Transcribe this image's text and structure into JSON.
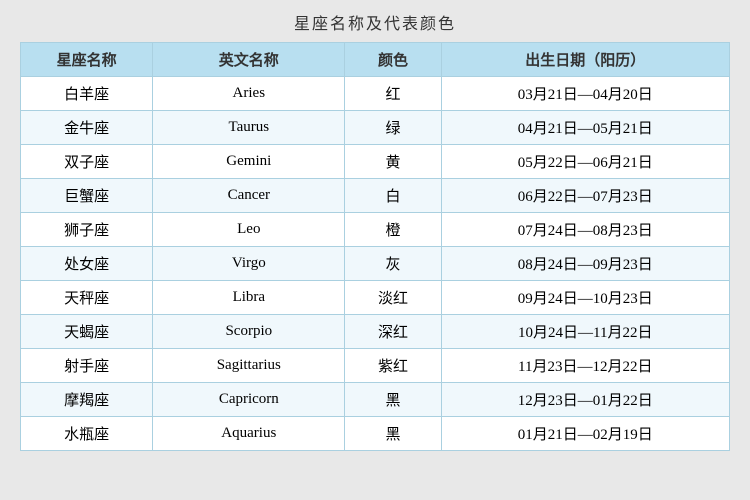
{
  "title": "星座名称及代表颜色",
  "headers": {
    "zh_name": "星座名称",
    "en_name": "英文名称",
    "color": "颜色",
    "date": "出生日期（阳历）"
  },
  "rows": [
    {
      "zh": "白羊座",
      "en": "Aries",
      "color": "红",
      "date": "03月21日—04月20日"
    },
    {
      "zh": "金牛座",
      "en": "Taurus",
      "color": "绿",
      "date": "04月21日—05月21日"
    },
    {
      "zh": "双子座",
      "en": "Gemini",
      "color": "黄",
      "date": "05月22日—06月21日"
    },
    {
      "zh": "巨蟹座",
      "en": "Cancer",
      "color": "白",
      "date": "06月22日—07月23日"
    },
    {
      "zh": "狮子座",
      "en": "Leo",
      "color": "橙",
      "date": "07月24日—08月23日"
    },
    {
      "zh": "处女座",
      "en": "Virgo",
      "color": "灰",
      "date": "08月24日—09月23日"
    },
    {
      "zh": "天秤座",
      "en": "Libra",
      "color": "淡红",
      "date": "09月24日—10月23日"
    },
    {
      "zh": "天蝎座",
      "en": "Scorpio",
      "color": "深红",
      "date": "10月24日—11月22日"
    },
    {
      "zh": "射手座",
      "en": "Sagittarius",
      "color": "紫红",
      "date": "11月23日—12月22日"
    },
    {
      "zh": "摩羯座",
      "en": "Capricorn",
      "color": "黑",
      "date": "12月23日—01月22日"
    },
    {
      "zh": "水瓶座",
      "en": "Aquarius",
      "color": "黑",
      "date": "01月21日—02月19日"
    }
  ]
}
